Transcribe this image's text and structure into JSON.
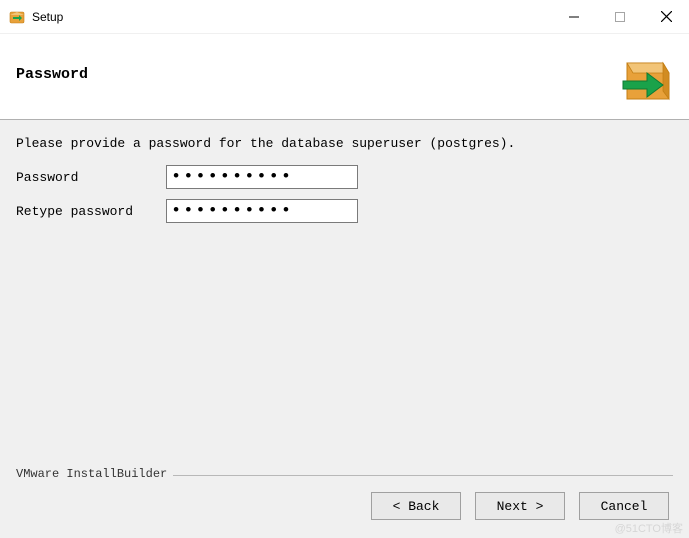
{
  "window": {
    "title": "Setup"
  },
  "header": {
    "title": "Password"
  },
  "content": {
    "instruction": "Please provide a password for the database superuser (postgres).",
    "password_label": "Password",
    "retype_label": "Retype password",
    "password_value": "●●●●●●●●●●",
    "retype_value": "●●●●●●●●●●"
  },
  "footer": {
    "builder_label": "VMware InstallBuilder",
    "back_label": "< Back",
    "next_label": "Next >",
    "cancel_label": "Cancel"
  },
  "watermark": "@51CTO博客"
}
